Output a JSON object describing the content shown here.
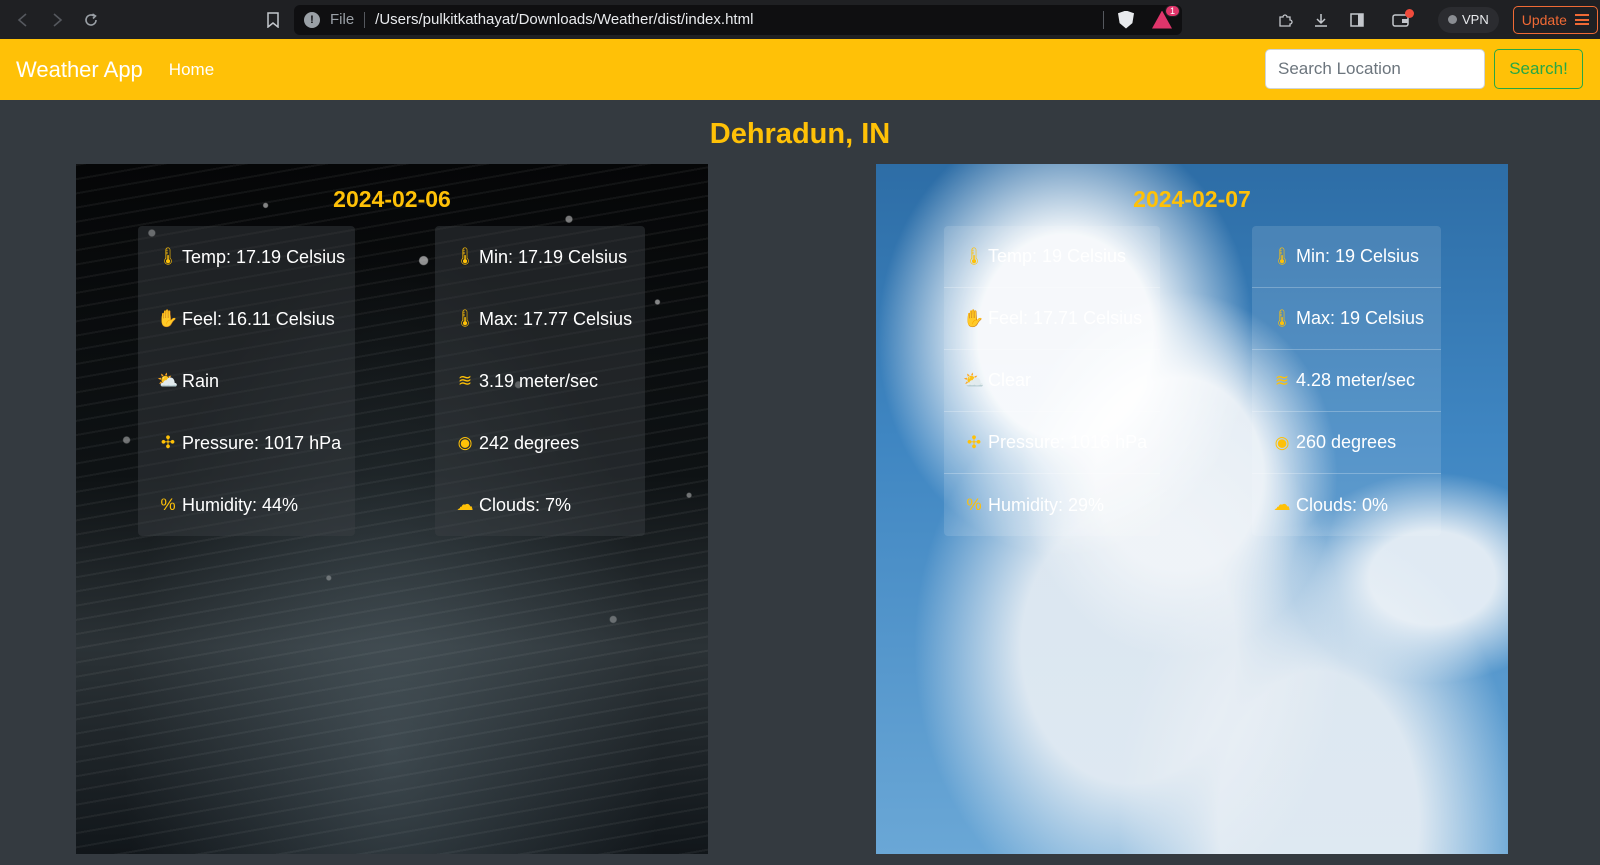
{
  "browser": {
    "file_label": "File",
    "url": "/Users/pulkitkathayat/Downloads/Weather/dist/index.html",
    "rewards_badge": "1",
    "vpn_label": "VPN",
    "update_label": "Update"
  },
  "navbar": {
    "brand": "Weather App",
    "home": "Home",
    "search_placeholder": "Search Location",
    "search_button": "Search!"
  },
  "location": "Dehradun, IN",
  "forecasts": [
    {
      "date": "2024-02-06",
      "left": {
        "temp": "Temp: 17.19 Celsius",
        "feel": "Feel: 16.11 Celsius",
        "condition": "Rain",
        "pressure": "Pressure: 1017 hPa",
        "humidity": "Humidity: 44%"
      },
      "right": {
        "min": "Min: 17.19 Celsius",
        "max": "Max: 17.77 Celsius",
        "wind": "3.19 meter/sec",
        "direction": "242 degrees",
        "clouds": "Clouds: 7%"
      }
    },
    {
      "date": "2024-02-07",
      "left": {
        "temp": "Temp: 19 Celsius",
        "feel": "Feel: 17.71 Celsius",
        "condition": "Clear",
        "pressure": "Pressure: 1016 hPa",
        "humidity": "Humidity: 29%"
      },
      "right": {
        "min": "Min: 19 Celsius",
        "max": "Max: 19 Celsius",
        "wind": "4.28 meter/sec",
        "direction": "260 degrees",
        "clouds": "Clouds: 0%"
      }
    }
  ],
  "icons": [
    "thermometer-icon",
    "temperature-low-icon",
    "temperature-high-icon",
    "hand-icon",
    "cloud-sun-icon",
    "wind-icon",
    "compress-icon",
    "compass-icon",
    "percent-icon",
    "cloud-icon"
  ],
  "colors": {
    "accent": "#ffc107",
    "success": "#28a745",
    "background": "#343a40"
  }
}
